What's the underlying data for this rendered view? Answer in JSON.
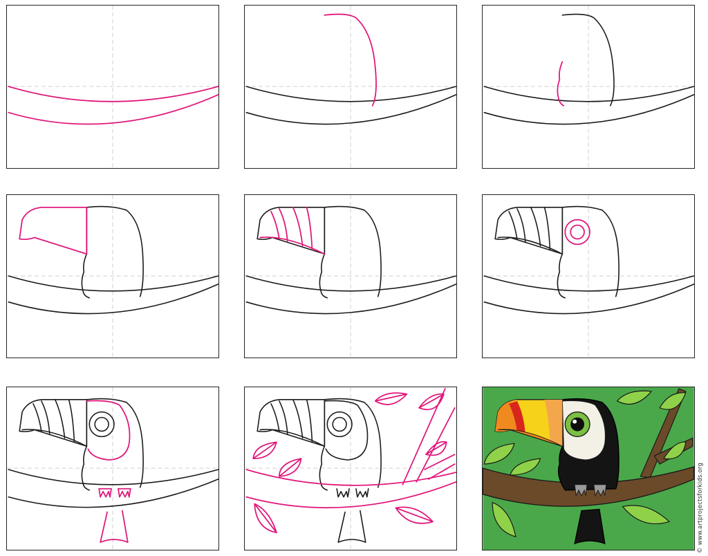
{
  "credit": "© www.artprojectsforkids.org",
  "colors": {
    "ink": "#1a1a1a",
    "new_step_line": "#e0187c",
    "guide_line": "#cfcfcf",
    "background_green": "#4aa84a",
    "branch_brown": "#6b4a2a",
    "leaf_green": "#8fd24a",
    "beak_yellow": "#f6d21a",
    "beak_orange": "#f08a1e",
    "beak_red": "#d8261d",
    "eye_green": "#7bc043"
  },
  "steps": [
    {
      "name": "step-1-branch"
    },
    {
      "name": "step-2-head-outline"
    },
    {
      "name": "step-3-neck"
    },
    {
      "name": "step-4-beak"
    },
    {
      "name": "step-5-beak-stripes"
    },
    {
      "name": "step-6-eye"
    },
    {
      "name": "step-7-face-feet-tail"
    },
    {
      "name": "step-8-leaves-branches"
    },
    {
      "name": "step-9-colored-final"
    }
  ]
}
